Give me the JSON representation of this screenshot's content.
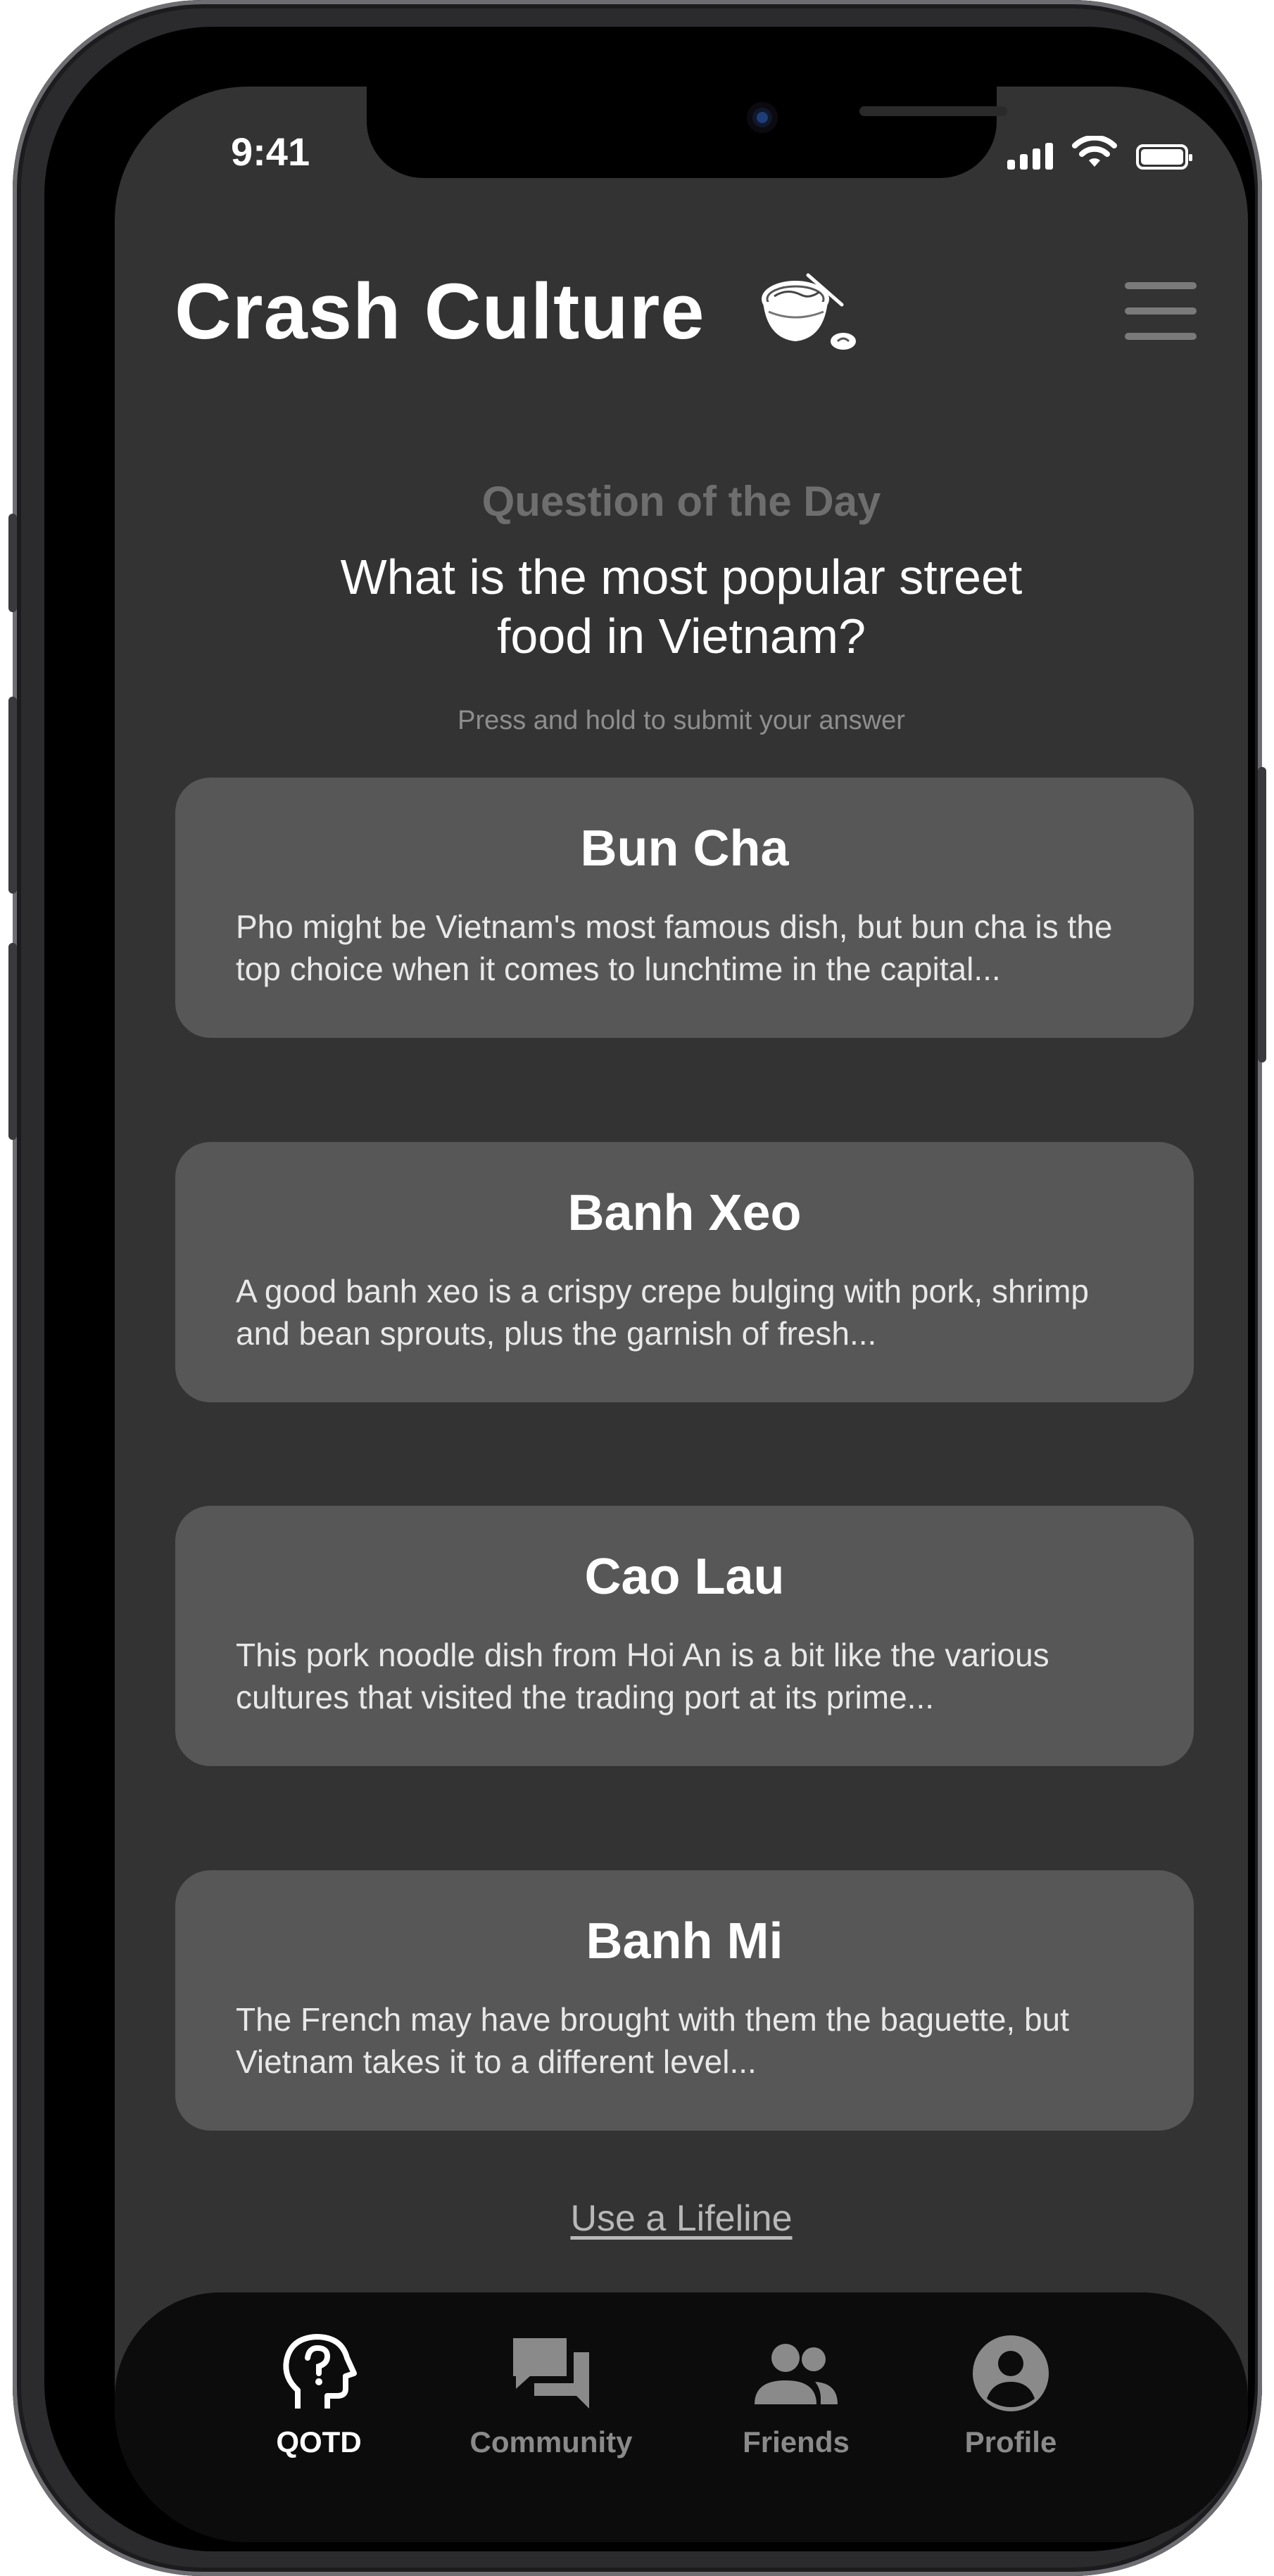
{
  "status_bar": {
    "time": "9:41"
  },
  "header": {
    "title": "Crash Culture"
  },
  "qotd": {
    "label": "Question of the Day",
    "question": "What is the most popular street food in Vietnam?",
    "hint": "Press and hold to submit your answer"
  },
  "answers": [
    {
      "title": "Bun Cha",
      "description": "Pho might be Vietnam's most famous dish, but bun cha is the top choice when it comes to lunchtime in the capital..."
    },
    {
      "title": "Banh Xeo",
      "description": "A good banh xeo is a crispy crepe bulging with pork, shrimp and bean sprouts, plus the garnish of fresh..."
    },
    {
      "title": "Cao Lau",
      "description": "This pork noodle dish from Hoi An is a bit like the various cultures that visited the trading port at its prime..."
    },
    {
      "title": "Banh Mi",
      "description": "The French may have brought with them the baguette, but Vietnam takes it to a different level..."
    }
  ],
  "lifeline_link": "Use a Lifeline",
  "tabs": [
    {
      "label": "QOTD",
      "icon": "head-question-icon",
      "active": true
    },
    {
      "label": "Community",
      "icon": "chat-bubbles-icon",
      "active": false
    },
    {
      "label": "Friends",
      "icon": "people-icon",
      "active": false
    },
    {
      "label": "Profile",
      "icon": "profile-icon",
      "active": false
    }
  ],
  "colors": {
    "screen_bg": "#333333",
    "card_bg": "#575757",
    "tabbar_bg": "#0c0c0c",
    "muted_label": "#6e6e6e"
  }
}
